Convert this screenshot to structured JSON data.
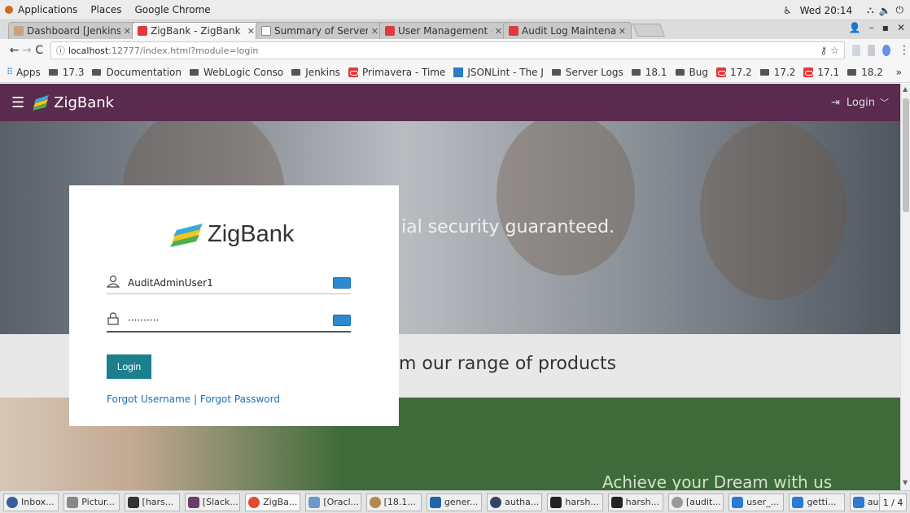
{
  "gnome": {
    "menu": [
      "Applications",
      "Places",
      "Google Chrome"
    ],
    "clock": "Wed 20:14"
  },
  "tabs": [
    {
      "title": "Dashboard [Jenkins]",
      "icon": "jenkins-icon",
      "active": false
    },
    {
      "title": "ZigBank - ZigBank",
      "icon": "oracle-icon",
      "active": true
    },
    {
      "title": "Summary of Servers",
      "icon": "document-icon",
      "active": false
    },
    {
      "title": "User Management -",
      "icon": "oracle-icon",
      "active": false
    },
    {
      "title": "Audit Log Maintenar",
      "icon": "oracle-icon",
      "active": false
    }
  ],
  "address": {
    "host": "localhost",
    "path": ":12777/index.html?module=login"
  },
  "bookmarks": [
    {
      "label": "Apps",
      "type": "apps"
    },
    {
      "label": "17.3",
      "type": "folder"
    },
    {
      "label": "Documentation",
      "type": "folder"
    },
    {
      "label": "WebLogic Conso",
      "type": "folder"
    },
    {
      "label": "Jenkins",
      "type": "folder"
    },
    {
      "label": "Primavera - Time",
      "type": "oracle"
    },
    {
      "label": "JSONLint - The J",
      "type": "json"
    },
    {
      "label": "Server Logs",
      "type": "folder"
    },
    {
      "label": "18.1",
      "type": "folder"
    },
    {
      "label": "Bug",
      "type": "folder"
    },
    {
      "label": "17.2",
      "type": "oracle"
    },
    {
      "label": "17.2",
      "type": "folder"
    },
    {
      "label": "17.1",
      "type": "oracle"
    },
    {
      "label": "18.2",
      "type": "folder"
    }
  ],
  "bookmarks_more": "»",
  "header": {
    "brand": "ZigBank",
    "login_label": "Login"
  },
  "hero": {
    "tagline_partial": "ial security guaranteed.",
    "products_partial": "m our range of products",
    "dream_partial": "Achieve your Dream with us"
  },
  "login_card": {
    "brand": "ZigBank",
    "username": "AuditAdminUser1",
    "password_mask": "··········",
    "button": "Login",
    "forgot_username": "Forgot Username",
    "separator": " | ",
    "forgot_password": "Forgot Password"
  },
  "taskbar": {
    "items": [
      {
        "label": "Inbox...",
        "color": "#3b5c9e",
        "active": false
      },
      {
        "label": "Pictur...",
        "color": "#888888",
        "active": false
      },
      {
        "label": "[hars...",
        "color": "#333333",
        "active": false
      },
      {
        "label": "[Slack...",
        "color": "#6b3f6b",
        "active": false
      },
      {
        "label": "ZigBa...",
        "color": "#e34b2d",
        "active": true
      },
      {
        "label": "[Oracl...",
        "color": "#6a9ac8",
        "active": false
      },
      {
        "label": "[18.1...",
        "color": "#b28850",
        "active": false
      },
      {
        "label": "gener...",
        "color": "#2266aa",
        "active": false
      },
      {
        "label": "autha...",
        "color": "#334466",
        "active": false
      },
      {
        "label": "harsh...",
        "color": "#222222",
        "active": false
      },
      {
        "label": "harsh...",
        "color": "#222222",
        "active": false
      },
      {
        "label": "[audit...",
        "color": "#999999",
        "active": false
      },
      {
        "label": "user_...",
        "color": "#2a7bd1",
        "active": false
      },
      {
        "label": "getti...",
        "color": "#2a7bd1",
        "active": false
      },
      {
        "label": "audit...",
        "color": "#2a7bd1",
        "active": false
      }
    ],
    "pager": "1 / 4"
  },
  "colors": {
    "header_bg": "#5a2a4f",
    "login_button": "#1b7f8e",
    "link": "#1e6fb8"
  }
}
